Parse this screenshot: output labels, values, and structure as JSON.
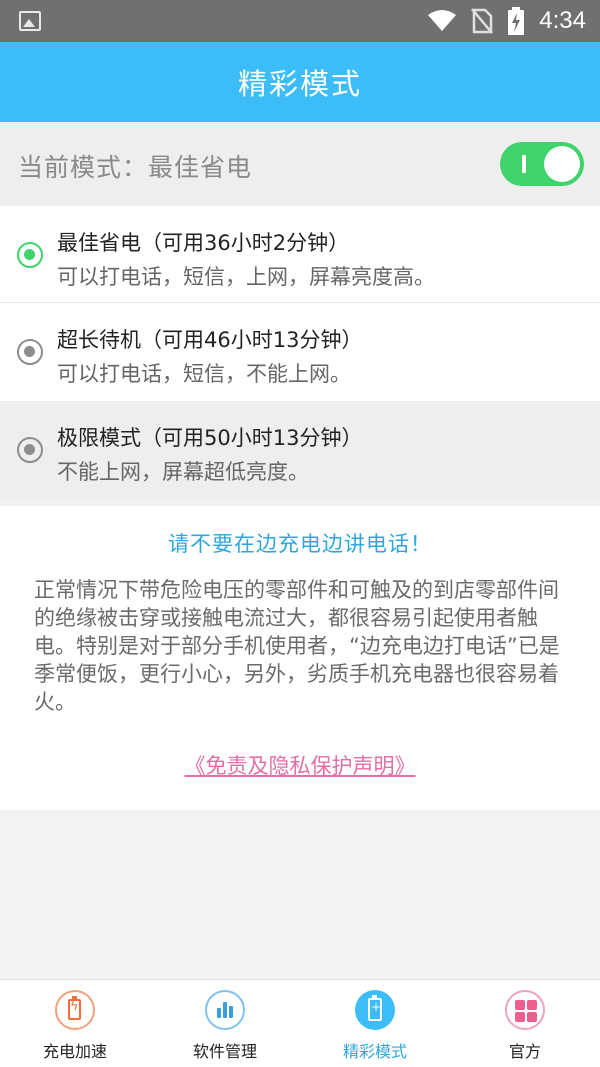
{
  "status_bar": {
    "time": "4:34",
    "icons": [
      "image-icon",
      "wifi-icon",
      "no-sim-icon",
      "battery-charging-icon"
    ]
  },
  "app_bar": {
    "title": "精彩模式"
  },
  "current_mode": {
    "label": "当前模式：最佳省电",
    "toggle_on": true
  },
  "options": [
    {
      "title": "最佳省电（可用36小时2分钟）",
      "desc": "可以打电话，短信，上网，屏幕亮度高。",
      "selected": true
    },
    {
      "title": "超长待机（可用46小时13分钟）",
      "desc": "可以打电话，短信，不能上网。",
      "selected": false
    },
    {
      "title": "极限模式（可用50小时13分钟）",
      "desc": "不能上网，屏幕超低亮度。",
      "selected": false
    }
  ],
  "info": {
    "warning": "请不要在边充电边讲电话！",
    "paragraph": "正常情况下带危险电压的零部件和可触及的到店零部件间的绝缘被击穿或接触电流过大，都很容易引起使用者触电。特别是对于部分手机使用者，“边充电边打电话”已是季常便饭，更行小心，另外，劣质手机充电器也很容易着火。",
    "link": "《免责及隐私保护声明》"
  },
  "bottom_nav": [
    {
      "label": "充电加速",
      "icon": "battery-charge-icon",
      "active": false
    },
    {
      "label": "软件管理",
      "icon": "bar-chart-icon",
      "active": false
    },
    {
      "label": "精彩模式",
      "icon": "battery-mode-icon",
      "active": true
    },
    {
      "label": "官方",
      "icon": "grid-icon",
      "active": false
    }
  ],
  "colors": {
    "primary": "#3cbdf7",
    "toggle_on": "#3ed46a",
    "link": "#e56ea6",
    "warning_text": "#2ca7df"
  }
}
